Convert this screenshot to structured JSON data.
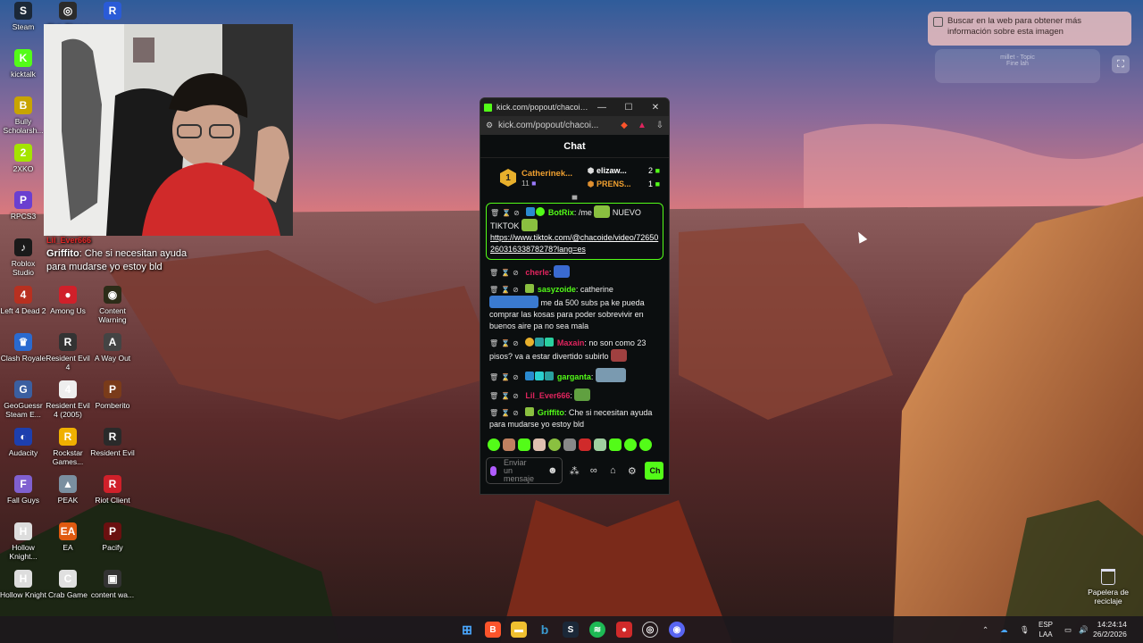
{
  "desktop": {
    "icons": [
      {
        "id": "steam",
        "label": "Steam",
        "color": "#1b2838",
        "glyph": "S"
      },
      {
        "id": "clairobscur",
        "label": "Clair Obscur",
        "color": "#2b2b2b",
        "glyph": "◎"
      },
      {
        "id": "roblox-app",
        "label": "",
        "color": "#2a5bd7",
        "glyph": "R"
      },
      {
        "id": "kicktalk",
        "label": "kicktalk",
        "color": "#53fc18",
        "glyph": "K"
      },
      {
        "id": "bully",
        "label": "Bully Scholarsh...",
        "color": "#c8a400",
        "glyph": "B"
      },
      {
        "id": "2xko",
        "label": "2XKO",
        "color": "#a4e400",
        "glyph": "2"
      },
      {
        "id": "rpcs3",
        "label": "RPCS3",
        "color": "#6a3fd0",
        "glyph": "P"
      },
      {
        "id": "roblox-studio",
        "label": "Roblox Studio",
        "color": "#1a1a1a",
        "glyph": "♪"
      },
      {
        "id": "left4dead2",
        "label": "Left 4 Dead 2",
        "color": "#b83020",
        "glyph": "4"
      },
      {
        "id": "amongus",
        "label": "Among Us",
        "color": "#d0202a",
        "glyph": "●"
      },
      {
        "id": "contentwarning",
        "label": "Content Warning",
        "color": "#2c2c18",
        "glyph": "◉"
      },
      {
        "id": "clashroyale",
        "label": "Clash Royale",
        "color": "#2a6ad0",
        "glyph": "♛"
      },
      {
        "id": "re4",
        "label": "Resident Evil 4",
        "color": "#333",
        "glyph": "R"
      },
      {
        "id": "awayout",
        "label": "A Way Out",
        "color": "#444",
        "glyph": "A"
      },
      {
        "id": "geoguessr",
        "label": "GeoGuessr Steam E...",
        "color": "#3b5fa0",
        "glyph": "G"
      },
      {
        "id": "re4-2005",
        "label": "Resident Evil 4 (2005)",
        "color": "#eee",
        "glyph": "4"
      },
      {
        "id": "pomberito",
        "label": "Pomberito",
        "color": "#7a3b1a",
        "glyph": "P"
      },
      {
        "id": "audacity",
        "label": "Audacity",
        "color": "#1d3fae",
        "glyph": "◐"
      },
      {
        "id": "rockstar",
        "label": "Rockstar Games...",
        "color": "#f0b000",
        "glyph": "R"
      },
      {
        "id": "re",
        "label": "Resident Evil",
        "color": "#2a2a2a",
        "glyph": "R"
      },
      {
        "id": "fallguys",
        "label": "Fall Guys",
        "color": "#8060d0",
        "glyph": "F"
      },
      {
        "id": "peak",
        "label": "PEAK",
        "color": "#7a8fa0",
        "glyph": "▲"
      },
      {
        "id": "riot",
        "label": "Riot Client",
        "color": "#d0202a",
        "glyph": "R"
      },
      {
        "id": "hollow1",
        "label": "Hollow Knight...",
        "color": "#ddd",
        "glyph": "H"
      },
      {
        "id": "ea",
        "label": "EA",
        "color": "#e05a10",
        "glyph": "EA"
      },
      {
        "id": "pacify",
        "label": "Pacify",
        "color": "#6a1010",
        "glyph": "P"
      },
      {
        "id": "hollow2",
        "label": "Hollow Knight",
        "color": "#ddd",
        "glyph": "H"
      },
      {
        "id": "crabgame",
        "label": "Crab Game",
        "color": "#e0e0e0",
        "glyph": "C"
      },
      {
        "id": "contentwa",
        "label": "content wa...",
        "color": "#333",
        "glyph": "▣"
      }
    ],
    "recycle_bin": "Papelera de reciclaje"
  },
  "overlay_chat": {
    "user1": "Lil_Ever666",
    "user2": "Griffito",
    "message": "Che si necesitan ayuda para mudarse yo estoy bld"
  },
  "search_tip": "Buscar en la web para obtener más información sobre esta imagen",
  "music_ghost": {
    "title": "millet - Topic",
    "sub": "Fine lah"
  },
  "popup": {
    "title": "kick.com/popout/chacoide/...",
    "url": "kick.com/popout/chacoi...",
    "chat_title": "Chat",
    "leaderboard": {
      "top": {
        "rank": "1",
        "name": "Catherinek...",
        "subs": "11"
      },
      "second": {
        "name": "elizaw...",
        "count": "2"
      },
      "third": {
        "name": "PRENS...",
        "count": "1"
      }
    },
    "messages": [
      {
        "user": "BotRix",
        "user_color": "#53fc18",
        "text": ": /me",
        "text2": "NUEVO TIKTOK",
        "link": "https://www.tiktok.com/@chacoide/video/7265026031633878278?lang=es"
      },
      {
        "user": "cherle",
        "user_color": "#e0245e",
        "text": ":"
      },
      {
        "user": "sasyzoide",
        "user_color": "#53fc18",
        "text": ": catherine",
        "text2": "me da 500 subs pa ke pueda comprar las kosas para poder sobrevivir en buenos aire pa no sea mala"
      },
      {
        "user": "Maxain",
        "user_color": "#e0245e",
        "text": ": no son como 23 pisos? va a estar divertido subirlo"
      },
      {
        "user": "garganta",
        "user_color": "#53fc18",
        "text": ":"
      },
      {
        "user": "Lil_Ever666",
        "user_color": "#e0245e",
        "text": ":"
      },
      {
        "user": "Griffito",
        "user_color": "#53fc18",
        "text": ": Che si necesitan ayuda para mudarse yo estoy bld"
      }
    ],
    "input_placeholder": "Enviar un mensaje",
    "send_label": "Ch"
  },
  "taskbar": {
    "lang": "ESP",
    "lang_sub": "LAA",
    "time": "14:24:14",
    "date": "26/2/2026"
  }
}
